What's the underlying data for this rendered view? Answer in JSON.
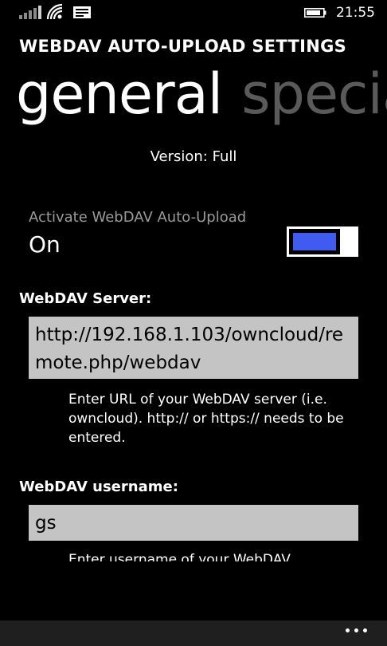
{
  "status_bar": {
    "time": "21:55",
    "icons": [
      "signal-icon",
      "wifi-icon",
      "message-icon",
      "battery-icon"
    ]
  },
  "app": {
    "title": "WEBDAV AUTO-UPLOAD SETTINGS"
  },
  "pivot": {
    "active": "general",
    "inactive": "special"
  },
  "version_text": "Version: Full",
  "activate": {
    "label": "Activate WebDAV Auto-Upload",
    "state": "On",
    "enabled": true,
    "accent_color": "#3f5bf0"
  },
  "server": {
    "label": "WebDAV Server:",
    "value": "http://192.168.1.103/owncloud/remote.php/webdav",
    "hint": "Enter URL of your WebDAV server (i.e. owncloud). http:// or https:// needs to be entered."
  },
  "username": {
    "label": "WebDAV username:",
    "value": "gs",
    "hint": "Enter username of your WebDAV"
  },
  "app_bar": {
    "more_icon": "more-dots-icon"
  }
}
